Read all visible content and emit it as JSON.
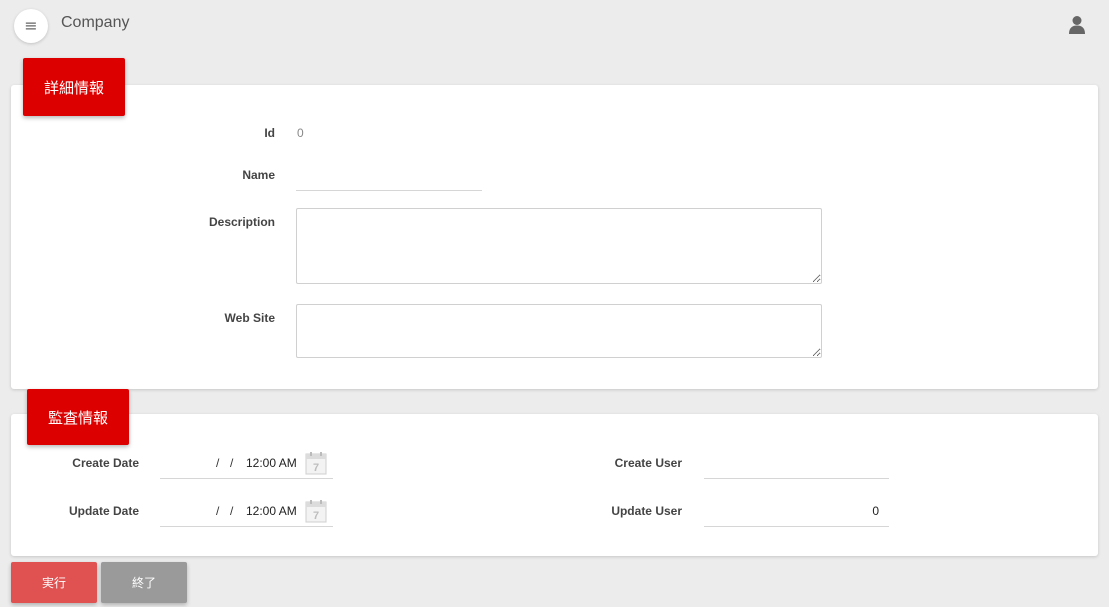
{
  "header": {
    "title": "Company",
    "menu_icon": "hamburger-menu-icon",
    "user_icon": "user-icon"
  },
  "detail_section": {
    "heading": "詳細情報",
    "id_label": "Id",
    "id_value": "0",
    "name_label": "Name",
    "name_value": "",
    "description_label": "Description",
    "description_value": "",
    "website_label": "Web Site",
    "website_value": ""
  },
  "audit_section": {
    "heading": "監査情報",
    "create_date_label": "Create Date",
    "create_date": {
      "sep1": "/",
      "sep2": "/",
      "time": "12:00 AM"
    },
    "update_date_label": "Update Date",
    "update_date": {
      "sep1": "/",
      "sep2": "/",
      "time": "12:00 AM"
    },
    "create_user_label": "Create User",
    "create_user_value": "",
    "update_user_label": "Update User",
    "update_user_value": "0",
    "calendar_icon": "calendar-icon"
  },
  "actions": {
    "execute_label": "実行",
    "close_label": "終了"
  },
  "colors": {
    "accent_red": "#dd0000",
    "execute_button": "#e05252",
    "close_button": "#9a9a9a",
    "background": "#ececec"
  }
}
